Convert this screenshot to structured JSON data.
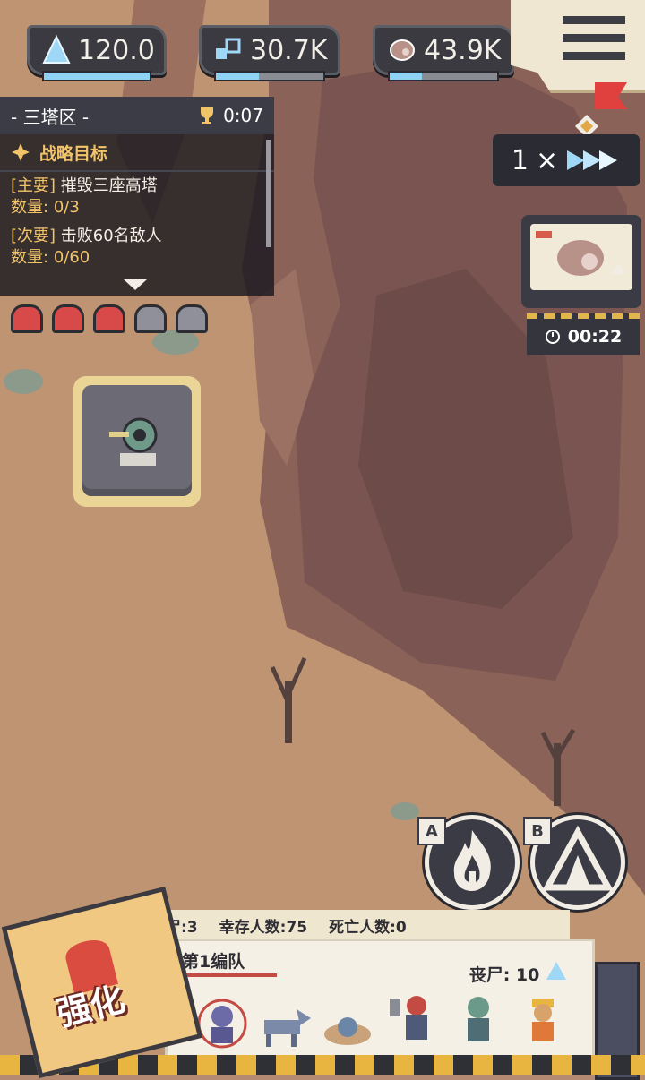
{
  "resources": [
    {
      "icon": "crystal-icon",
      "value": "120.0",
      "progress": 1.0
    },
    {
      "icon": "gear-parts-icon",
      "value": "30.7K",
      "progress": 0.4
    },
    {
      "icon": "meat-icon",
      "value": "43.9K",
      "progress": 0.3
    }
  ],
  "mission": {
    "title": "- 三塔区 -",
    "timer": "0:07",
    "section": "战略目标",
    "objectives": [
      {
        "tag": "[主要]",
        "text": "摧毁三座高塔",
        "count_label": "数量:",
        "count": "0/3"
      },
      {
        "tag": "[次要]",
        "text": "击败60名敌人",
        "count_label": "数量:",
        "count": "0/60"
      }
    ]
  },
  "lives": {
    "active": 3,
    "total": 5
  },
  "speed": {
    "multiplier": "1",
    "symbol": "×"
  },
  "video_timer": "00:22",
  "skills": [
    {
      "key": "A",
      "icon": "flame-icon"
    },
    {
      "key": "B",
      "icon": "tent-icon"
    }
  ],
  "stats": {
    "zombies": "丧尸:3",
    "survivors": "幸存人数:75",
    "dead": "死亡人数:0"
  },
  "squad": {
    "name": "第1编队",
    "corpse": "丧尸: 10",
    "units": [
      "zombie-unit-icon",
      "dog-unit-icon",
      "crawler-unit-icon",
      "brute-unit-icon",
      "ghoul-unit-icon",
      "worker-unit-icon"
    ]
  },
  "upgrade_label": "强化",
  "colors": {
    "accent": "#f2c46a",
    "panel": "#3b3c46",
    "progress": "#8ed3f4"
  }
}
